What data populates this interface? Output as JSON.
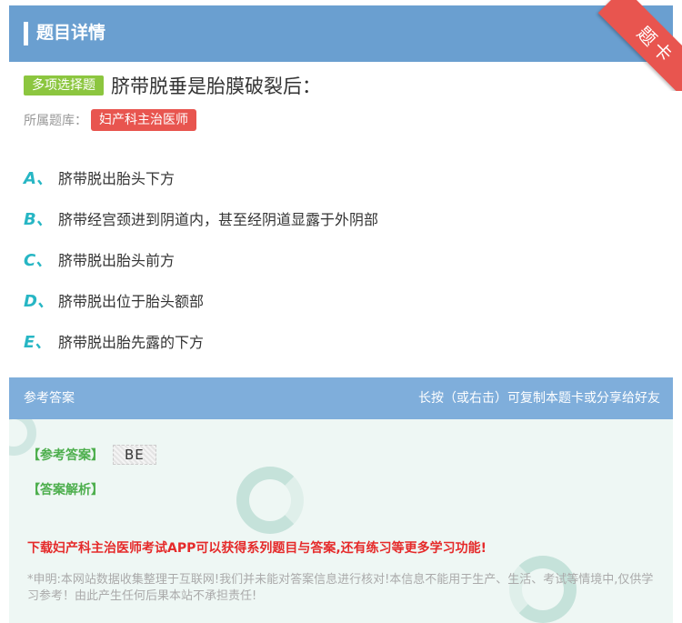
{
  "header": {
    "title": "题目详情"
  },
  "corner_badge": "题卡",
  "question": {
    "type_tag": "多项选择题",
    "text": "脐带脱垂是胎膜破裂后：",
    "bank_label": "所属题库：",
    "bank_name": "妇产科主治医师"
  },
  "options": [
    {
      "letter": "A、",
      "text": "脐带脱出胎头下方"
    },
    {
      "letter": "B、",
      "text": "脐带经宫颈进到阴道内，甚至经阴道显露于外阴部"
    },
    {
      "letter": "C、",
      "text": "脐带脱出胎头前方"
    },
    {
      "letter": "D、",
      "text": "脐带脱出位于胎头额部"
    },
    {
      "letter": "E、",
      "text": "脐带脱出胎先露的下方"
    }
  ],
  "answer_bar": {
    "label": "参考答案",
    "hint": "长按（或右击）可复制本题卡或分享给好友"
  },
  "answer": {
    "ref_label": "【参考答案】",
    "ref_value": "BE",
    "analysis_label": "【答案解析】",
    "promo": "下载妇产科主治医师考试APP可以获得系列题目与答案,还有练习等更多学习功能!",
    "disclaimer": "*申明:本网站数据收集整理于互联网!我们并未能对答案信息进行核对!本信息不能用于生产、生活、考试等情境中,仅供学习参考！由此产生任何后果本站不承担责任!"
  },
  "colors": {
    "header": "#6a9fd0",
    "badge": "#e8554f",
    "type_tag": "#8cc63f",
    "option_letter": "#27b6c4",
    "answer_label": "#4cae4c",
    "promo": "#e52a2a"
  }
}
